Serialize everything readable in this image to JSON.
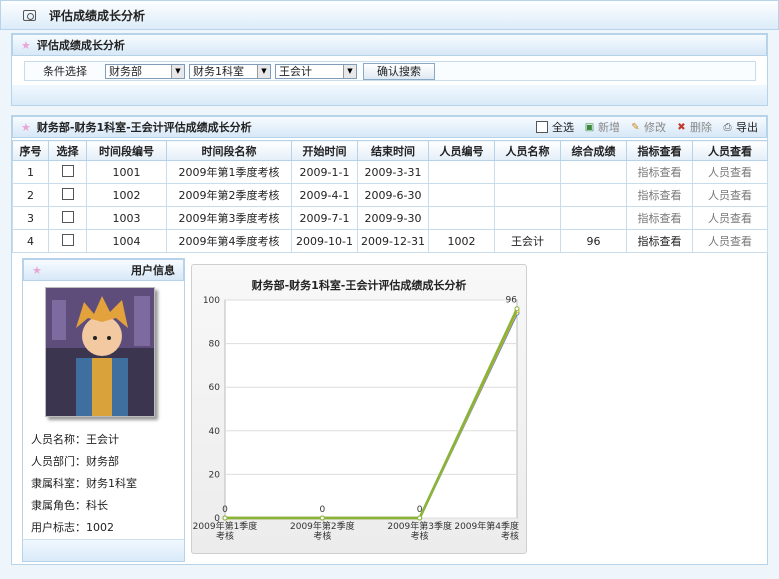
{
  "page": {
    "title": "评估成绩成长分析"
  },
  "filter": {
    "title": "评估成绩成长分析",
    "label": "条件选择",
    "dept": "财务部",
    "office": "财务1科室",
    "person": "王会计",
    "search_label": "确认搜索"
  },
  "results": {
    "title": "财务部-财务1科室-王会计评估成绩成长分析",
    "toolbar": {
      "select_all": "全选",
      "add": "新增",
      "edit": "修改",
      "delete": "删除",
      "export": "导出"
    },
    "columns": [
      "序号",
      "选择",
      "时间段编号",
      "时间段名称",
      "开始时间",
      "结束时间",
      "人员编号",
      "人员名称",
      "综合成绩",
      "指标查看",
      "人员查看"
    ],
    "rows": [
      {
        "no": "1",
        "code": "1001",
        "name": "2009年第1季度考核",
        "start": "2009-1-1",
        "end": "2009-3-31",
        "pid": "",
        "pname": "",
        "score": "",
        "metric": "指标查看",
        "people": "人员查看"
      },
      {
        "no": "2",
        "code": "1002",
        "name": "2009年第2季度考核",
        "start": "2009-4-1",
        "end": "2009-6-30",
        "pid": "",
        "pname": "",
        "score": "",
        "metric": "指标查看",
        "people": "人员查看"
      },
      {
        "no": "3",
        "code": "1003",
        "name": "2009年第3季度考核",
        "start": "2009-7-1",
        "end": "2009-9-30",
        "pid": "",
        "pname": "",
        "score": "",
        "metric": "指标查看",
        "people": "人员查看"
      },
      {
        "no": "4",
        "code": "1004",
        "name": "2009年第4季度考核",
        "start": "2009-10-1",
        "end": "2009-12-31",
        "pid": "1002",
        "pname": "王会计",
        "score": "96",
        "metric": "指标查看",
        "people": "人员查看"
      }
    ]
  },
  "user": {
    "title": "用户信息",
    "fields": [
      {
        "label": "人员名称：",
        "value": "王会计"
      },
      {
        "label": "人员部门：",
        "value": "财务部"
      },
      {
        "label": "隶属科室：",
        "value": "财务1科室"
      },
      {
        "label": "隶属角色：",
        "value": "科长"
      },
      {
        "label": "用户标志：",
        "value": "1002"
      }
    ]
  },
  "chart_data": {
    "type": "line",
    "title": "财务部-财务1科室-王会计评估成绩成长分析",
    "categories": [
      "2009年第1季度考核",
      "2009年第2季度考核",
      "2009年第3季度考核",
      "2009年第4季度考核"
    ],
    "series": [
      {
        "values": [
          0,
          0,
          0,
          96
        ],
        "color": "#86b53a"
      },
      {
        "values": [
          0,
          0,
          0,
          95
        ],
        "color": "#f2a516"
      },
      {
        "values": [
          0,
          0,
          0,
          94
        ],
        "color": "#4a8bd1"
      }
    ],
    "data_labels": [
      "0",
      "0",
      "0",
      "96"
    ],
    "ylim": [
      0,
      100
    ],
    "yticks": [
      0,
      20,
      40,
      60,
      80,
      100
    ],
    "grid": true,
    "colors": {
      "accent": "#b7d3ea",
      "line": "#86b53a"
    }
  }
}
